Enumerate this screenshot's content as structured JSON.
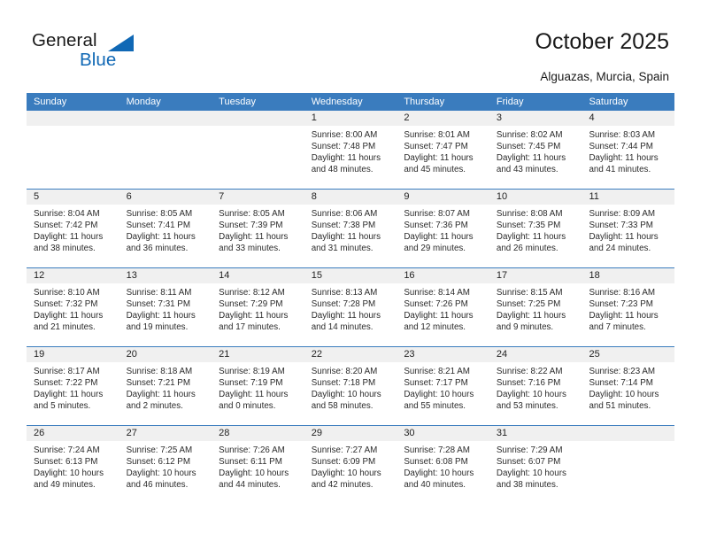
{
  "logo": {
    "word1": "General",
    "word2": "Blue",
    "accent_color": "#1068b5",
    "triangle_icon": "triangle-icon"
  },
  "header": {
    "title": "October 2025",
    "location": "Alguazas, Murcia, Spain"
  },
  "calendar": {
    "header_color": "#3a7cbe",
    "date_band_color": "#f0f0f0",
    "weekdays": [
      "Sunday",
      "Monday",
      "Tuesday",
      "Wednesday",
      "Thursday",
      "Friday",
      "Saturday"
    ],
    "labels": {
      "sunrise": "Sunrise:",
      "sunset": "Sunset:",
      "daylight": "Daylight:"
    },
    "weeks": [
      [
        {
          "day": "",
          "empty": true
        },
        {
          "day": "",
          "empty": true
        },
        {
          "day": "",
          "empty": true
        },
        {
          "day": "1",
          "sunrise": "Sunrise: 8:00 AM",
          "sunset": "Sunset: 7:48 PM",
          "daylight1": "Daylight: 11 hours",
          "daylight2": "and 48 minutes."
        },
        {
          "day": "2",
          "sunrise": "Sunrise: 8:01 AM",
          "sunset": "Sunset: 7:47 PM",
          "daylight1": "Daylight: 11 hours",
          "daylight2": "and 45 minutes."
        },
        {
          "day": "3",
          "sunrise": "Sunrise: 8:02 AM",
          "sunset": "Sunset: 7:45 PM",
          "daylight1": "Daylight: 11 hours",
          "daylight2": "and 43 minutes."
        },
        {
          "day": "4",
          "sunrise": "Sunrise: 8:03 AM",
          "sunset": "Sunset: 7:44 PM",
          "daylight1": "Daylight: 11 hours",
          "daylight2": "and 41 minutes."
        }
      ],
      [
        {
          "day": "5",
          "sunrise": "Sunrise: 8:04 AM",
          "sunset": "Sunset: 7:42 PM",
          "daylight1": "Daylight: 11 hours",
          "daylight2": "and 38 minutes."
        },
        {
          "day": "6",
          "sunrise": "Sunrise: 8:05 AM",
          "sunset": "Sunset: 7:41 PM",
          "daylight1": "Daylight: 11 hours",
          "daylight2": "and 36 minutes."
        },
        {
          "day": "7",
          "sunrise": "Sunrise: 8:05 AM",
          "sunset": "Sunset: 7:39 PM",
          "daylight1": "Daylight: 11 hours",
          "daylight2": "and 33 minutes."
        },
        {
          "day": "8",
          "sunrise": "Sunrise: 8:06 AM",
          "sunset": "Sunset: 7:38 PM",
          "daylight1": "Daylight: 11 hours",
          "daylight2": "and 31 minutes."
        },
        {
          "day": "9",
          "sunrise": "Sunrise: 8:07 AM",
          "sunset": "Sunset: 7:36 PM",
          "daylight1": "Daylight: 11 hours",
          "daylight2": "and 29 minutes."
        },
        {
          "day": "10",
          "sunrise": "Sunrise: 8:08 AM",
          "sunset": "Sunset: 7:35 PM",
          "daylight1": "Daylight: 11 hours",
          "daylight2": "and 26 minutes."
        },
        {
          "day": "11",
          "sunrise": "Sunrise: 8:09 AM",
          "sunset": "Sunset: 7:33 PM",
          "daylight1": "Daylight: 11 hours",
          "daylight2": "and 24 minutes."
        }
      ],
      [
        {
          "day": "12",
          "sunrise": "Sunrise: 8:10 AM",
          "sunset": "Sunset: 7:32 PM",
          "daylight1": "Daylight: 11 hours",
          "daylight2": "and 21 minutes."
        },
        {
          "day": "13",
          "sunrise": "Sunrise: 8:11 AM",
          "sunset": "Sunset: 7:31 PM",
          "daylight1": "Daylight: 11 hours",
          "daylight2": "and 19 minutes."
        },
        {
          "day": "14",
          "sunrise": "Sunrise: 8:12 AM",
          "sunset": "Sunset: 7:29 PM",
          "daylight1": "Daylight: 11 hours",
          "daylight2": "and 17 minutes."
        },
        {
          "day": "15",
          "sunrise": "Sunrise: 8:13 AM",
          "sunset": "Sunset: 7:28 PM",
          "daylight1": "Daylight: 11 hours",
          "daylight2": "and 14 minutes."
        },
        {
          "day": "16",
          "sunrise": "Sunrise: 8:14 AM",
          "sunset": "Sunset: 7:26 PM",
          "daylight1": "Daylight: 11 hours",
          "daylight2": "and 12 minutes."
        },
        {
          "day": "17",
          "sunrise": "Sunrise: 8:15 AM",
          "sunset": "Sunset: 7:25 PM",
          "daylight1": "Daylight: 11 hours",
          "daylight2": "and 9 minutes."
        },
        {
          "day": "18",
          "sunrise": "Sunrise: 8:16 AM",
          "sunset": "Sunset: 7:23 PM",
          "daylight1": "Daylight: 11 hours",
          "daylight2": "and 7 minutes."
        }
      ],
      [
        {
          "day": "19",
          "sunrise": "Sunrise: 8:17 AM",
          "sunset": "Sunset: 7:22 PM",
          "daylight1": "Daylight: 11 hours",
          "daylight2": "and 5 minutes."
        },
        {
          "day": "20",
          "sunrise": "Sunrise: 8:18 AM",
          "sunset": "Sunset: 7:21 PM",
          "daylight1": "Daylight: 11 hours",
          "daylight2": "and 2 minutes."
        },
        {
          "day": "21",
          "sunrise": "Sunrise: 8:19 AM",
          "sunset": "Sunset: 7:19 PM",
          "daylight1": "Daylight: 11 hours",
          "daylight2": "and 0 minutes."
        },
        {
          "day": "22",
          "sunrise": "Sunrise: 8:20 AM",
          "sunset": "Sunset: 7:18 PM",
          "daylight1": "Daylight: 10 hours",
          "daylight2": "and 58 minutes."
        },
        {
          "day": "23",
          "sunrise": "Sunrise: 8:21 AM",
          "sunset": "Sunset: 7:17 PM",
          "daylight1": "Daylight: 10 hours",
          "daylight2": "and 55 minutes."
        },
        {
          "day": "24",
          "sunrise": "Sunrise: 8:22 AM",
          "sunset": "Sunset: 7:16 PM",
          "daylight1": "Daylight: 10 hours",
          "daylight2": "and 53 minutes."
        },
        {
          "day": "25",
          "sunrise": "Sunrise: 8:23 AM",
          "sunset": "Sunset: 7:14 PM",
          "daylight1": "Daylight: 10 hours",
          "daylight2": "and 51 minutes."
        }
      ],
      [
        {
          "day": "26",
          "sunrise": "Sunrise: 7:24 AM",
          "sunset": "Sunset: 6:13 PM",
          "daylight1": "Daylight: 10 hours",
          "daylight2": "and 49 minutes."
        },
        {
          "day": "27",
          "sunrise": "Sunrise: 7:25 AM",
          "sunset": "Sunset: 6:12 PM",
          "daylight1": "Daylight: 10 hours",
          "daylight2": "and 46 minutes."
        },
        {
          "day": "28",
          "sunrise": "Sunrise: 7:26 AM",
          "sunset": "Sunset: 6:11 PM",
          "daylight1": "Daylight: 10 hours",
          "daylight2": "and 44 minutes."
        },
        {
          "day": "29",
          "sunrise": "Sunrise: 7:27 AM",
          "sunset": "Sunset: 6:09 PM",
          "daylight1": "Daylight: 10 hours",
          "daylight2": "and 42 minutes."
        },
        {
          "day": "30",
          "sunrise": "Sunrise: 7:28 AM",
          "sunset": "Sunset: 6:08 PM",
          "daylight1": "Daylight: 10 hours",
          "daylight2": "and 40 minutes."
        },
        {
          "day": "31",
          "sunrise": "Sunrise: 7:29 AM",
          "sunset": "Sunset: 6:07 PM",
          "daylight1": "Daylight: 10 hours",
          "daylight2": "and 38 minutes."
        },
        {
          "day": "",
          "empty": true
        }
      ]
    ]
  }
}
